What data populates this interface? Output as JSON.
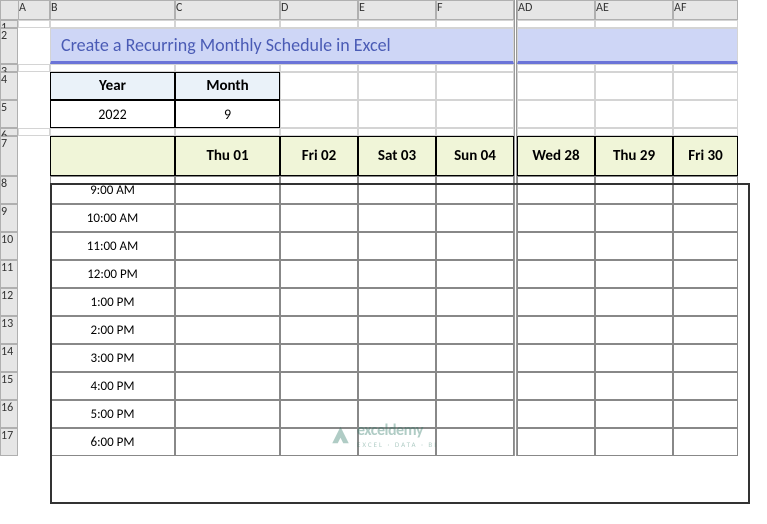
{
  "columns": [
    "A",
    "B",
    "C",
    "D",
    "E",
    "F",
    "AD",
    "AE",
    "AF"
  ],
  "rows": [
    "1",
    "2",
    "3",
    "4",
    "5",
    "6",
    "7",
    "8",
    "9",
    "10",
    "11",
    "12",
    "13",
    "14",
    "15",
    "16",
    "17"
  ],
  "title": "Create a Recurring Monthly Schedule in Excel",
  "year_month": {
    "year_label": "Year",
    "month_label": "Month",
    "year_value": "2022",
    "month_value": "9"
  },
  "days": [
    "Thu 01",
    "Fri 02",
    "Sat 03",
    "Sun 04",
    "Wed 28",
    "Thu 29",
    "Fri 30"
  ],
  "times": [
    "9:00 AM",
    "10:00 AM",
    "11:00 AM",
    "12:00 PM",
    "1:00 PM",
    "2:00 PM",
    "3:00 PM",
    "4:00 PM",
    "5:00 PM",
    "6:00 PM"
  ],
  "watermark": {
    "brand": "exceldemy",
    "tagline": "EXCEL · DATA · BI"
  }
}
